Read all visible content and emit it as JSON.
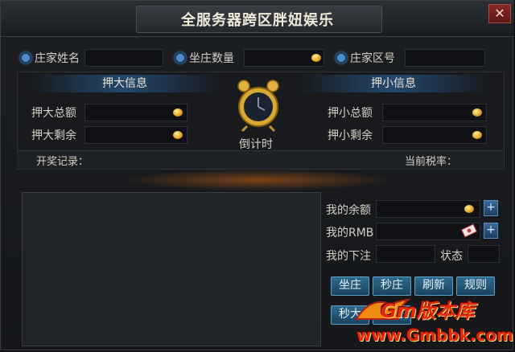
{
  "window": {
    "title": "全服务器跨区胖妞娱乐",
    "close_glyph": "✕"
  },
  "banker": {
    "name_label": "庄家姓名",
    "amount_label": "坐庄数量",
    "zone_label": "庄家区号"
  },
  "big": {
    "header": "押大信息",
    "total_label": "押大总额",
    "remain_label": "押大剩余"
  },
  "small": {
    "header": "押小信息",
    "total_label": "押小总额",
    "remain_label": "押小剩余"
  },
  "countdown_label": "倒计时",
  "record": {
    "label": "开奖记录：",
    "tax_label": "当前税率："
  },
  "mine": {
    "balance_label": "我的余额",
    "rmb_label": "我的RMB",
    "bet_label": "我的下注",
    "status_label": "状态"
  },
  "buttons": {
    "sit": "坐庄",
    "seckill_banker": "秒庄",
    "refresh": "刷新",
    "rules": "规则",
    "seckill_big": "秒大",
    "bet_big": "押大"
  },
  "watermark": {
    "brand": "Gm版本库",
    "url": "www.Gmbbk.com"
  },
  "colors": {
    "accent": "#2e6a8c",
    "coin": "#e0a020",
    "watermark_red": "#e02a10"
  }
}
